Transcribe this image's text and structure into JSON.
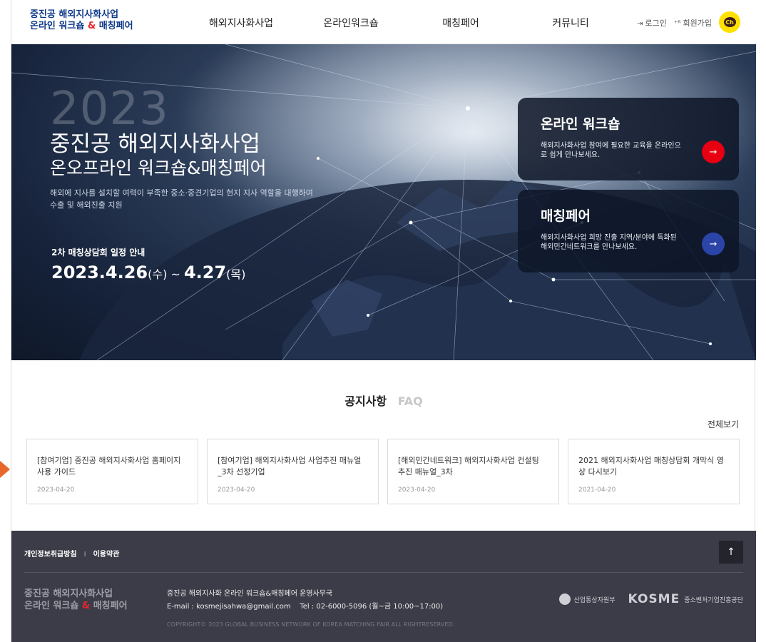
{
  "header": {
    "logo_line1": "중진공 해외지사화사업",
    "logo_line2_a": "온라인 워크숍",
    "logo_amp": "&",
    "logo_line2_b": "매칭페어",
    "nav": [
      "해외지사화사업",
      "온라인워크숍",
      "매칭페어",
      "커뮤니티"
    ],
    "login": "로그인",
    "signup": "회원가입",
    "kakao": "Ch"
  },
  "hero": {
    "year": "2023",
    "title1": "중진공 해외지사화사업",
    "title2": "온오프라인 워크숍&매칭페어",
    "desc": "해외에 지사를 설치할 여력이 부족한 중소·중견기업의 현지 지사 역할을 대행하여 수출 및 해외진출 지원",
    "schedule_label": "2차 매칭상담회 일정 안내",
    "date1": "2023.4.26",
    "day1": "(수)",
    "tilde": " ~ ",
    "date2": "4.27",
    "day2": "(목)",
    "card1": {
      "title": "온라인 워크숍",
      "desc": "해외지사화사업 참여에 필요한 교육을 온라인으로 쉽게 만나보세요.",
      "arrow": "→"
    },
    "card2": {
      "title": "매칭페어",
      "desc": "해외지사화사업 희망 진출 지역/분야에 특화된 해외민간네트워크를 만나보세요.",
      "arrow": "→"
    }
  },
  "notice": {
    "tab_active": "공지사항",
    "tab_inactive": "FAQ",
    "view_all": "전체보기",
    "items": [
      {
        "title": "[참여기업] 중진공 해외지사화사업 홈페이지 사용 가이드",
        "date": "2023-04-20"
      },
      {
        "title": "[참여기업] 해외지사화사업 사업추진 매뉴얼_3차 선정기업",
        "date": "2023-04-20"
      },
      {
        "title": "[해외민간네트워크] 해외지사화사업 컨설팅 추진 매뉴얼_3차",
        "date": "2023-04-20"
      },
      {
        "title": "2021 해외지사화사업 매칭상담회 개막식 영상 다시보기",
        "date": "2021-04-20"
      }
    ]
  },
  "footer": {
    "privacy": "개인정보취급방침",
    "sep": "I",
    "terms": "이용약관",
    "top": "↑",
    "logo_line1": "중진공 해외지사화사업",
    "logo_line2_a": "온라인 워크숍",
    "logo_amp": "&",
    "logo_line2_b": "매칭페어",
    "office": "중진공 해외지사화 온라인 워크숍&매칭페어 운영사무국",
    "email": "E-mail : kosmejisahwa@gmail.com",
    "tel": "Tel : 02-6000-5096 (월~금 10:00~17:00)",
    "copyright": "COPYRIGHT© 2023 GLOBAL BUSINESS NETWORK OF KOREA MATCHING FAIR ALL RIGHTRESERVED.",
    "org1": "산업통상자원부",
    "org2_logo": "KOSME",
    "org2_name": "중소벤처기업진흥공단"
  }
}
